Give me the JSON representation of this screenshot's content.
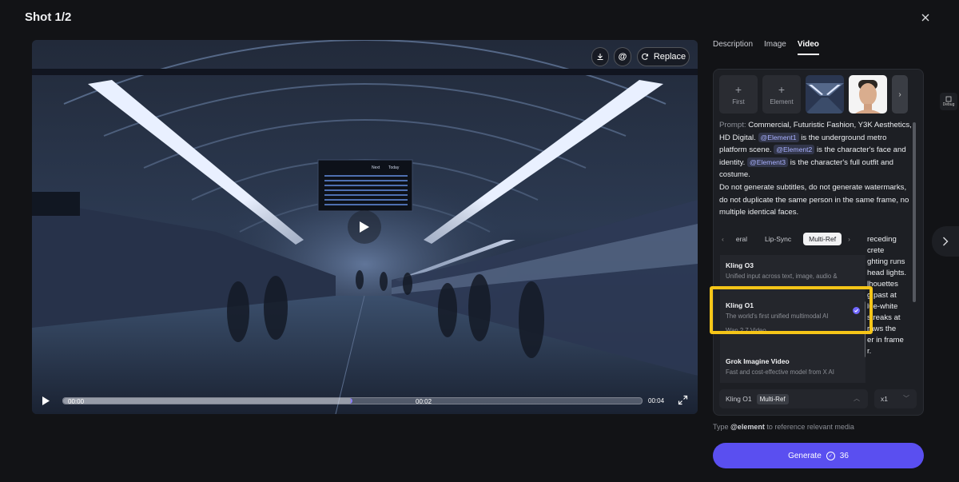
{
  "header": {
    "title": "Shot 1/2"
  },
  "video": {
    "top_buttons": {
      "replace_label": "Replace"
    },
    "departure_board": {
      "header": [
        "Next",
        "Today"
      ]
    },
    "controls": {
      "current_time": "00:00",
      "marker_time": "00:02",
      "end_time": "00:04",
      "progress": 0.5
    }
  },
  "tabs": [
    {
      "label": "Description",
      "active": false
    },
    {
      "label": "Image",
      "active": false
    },
    {
      "label": "Video",
      "active": true
    }
  ],
  "panel": {
    "thumbs": {
      "first_label": "First",
      "element_label": "Element"
    },
    "prompt": {
      "label": "Prompt:",
      "text1": "Commercial, Futuristic Fashion, Y3K Aesthetics, HD Digital.",
      "tag1": "@Element1",
      "text2": "is the underground metro platform scene.",
      "tag2": "@Element2",
      "text3": "is the character's face and identity.",
      "tag3": "@Element3",
      "text4": "is the character's full outfit and costume.",
      "text5": "Do not generate subtitles, do not generate watermarks, do not duplicate the same person in the same frame, no multiple identical faces."
    },
    "overflow_lines": [
      "receding",
      "crete",
      "ghting runs",
      "head lights.",
      "lhouettes",
      "g past at",
      "lue-white",
      "streaks at",
      "raws the",
      "er in frame",
      "r."
    ],
    "modes": [
      "eral",
      "Lip-Sync",
      "Multi-Ref"
    ],
    "models": [
      {
        "name": "Kling O3",
        "desc": "Unified input across text, image, audio &"
      },
      {
        "name": "Kling O1",
        "desc": "The world's first unified multimodal AI",
        "selected": true
      },
      {
        "name": "",
        "desc": "Wan 2.7 Video"
      },
      {
        "name": "Grok Imagine Video",
        "desc": "Fast and cost-effective model from X AI"
      }
    ],
    "footer": {
      "model": "Kling O1",
      "mode": "Multi-Ref",
      "count": "x1"
    }
  },
  "hint": {
    "prefix": "Type",
    "keyword": "@element",
    "suffix": "to reference relevant media"
  },
  "generate": {
    "label": "Generate",
    "cost": "36"
  },
  "debug_label": "Debug",
  "colors": {
    "accent": "#5a4ff0",
    "highlight": "#f5c518"
  }
}
